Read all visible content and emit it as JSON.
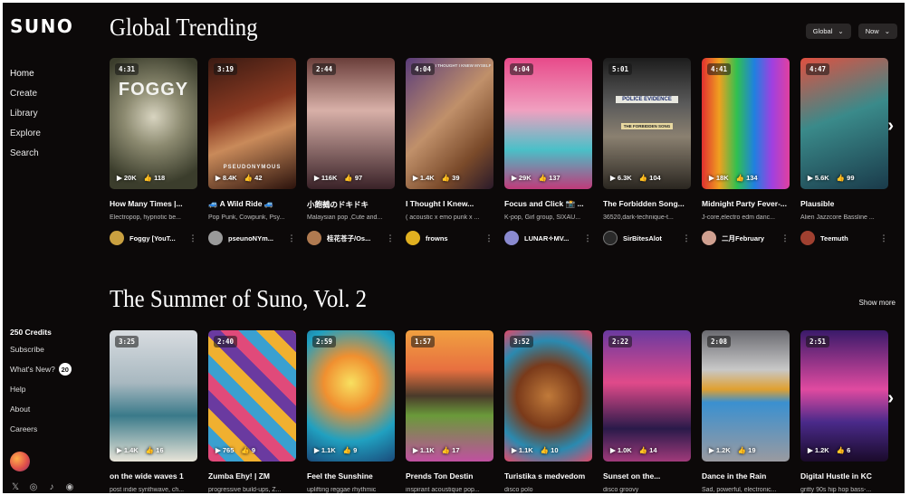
{
  "app": {
    "logo": "SUNO"
  },
  "sidebar": {
    "nav": [
      "Home",
      "Create",
      "Library",
      "Explore",
      "Search"
    ],
    "credits": "250 Credits",
    "subscribe": "Subscribe",
    "whats_new": "What's New?",
    "whats_new_count": "20",
    "help": "Help",
    "about": "About",
    "careers": "Careers",
    "socials": [
      "x-icon",
      "instagram-icon",
      "tiktok-icon",
      "discord-icon"
    ]
  },
  "trending": {
    "title": "Global Trending",
    "filter_region": "Global",
    "filter_time": "Now",
    "songs": [
      {
        "duration": "4:31",
        "plays": "20K",
        "likes": "118",
        "title": "How Many Times |...",
        "genre": "Electropop, hypnotic be...",
        "artist": "Foggy [YouT..."
      },
      {
        "duration": "3:19",
        "plays": "8.4K",
        "likes": "42",
        "title": "🚙 A Wild Ride 🚙",
        "genre": "Pop Punk, Cowpunk, Psy...",
        "artist": "pseunoNYm..."
      },
      {
        "duration": "2:44",
        "plays": "116K",
        "likes": "97",
        "title": "小飽鵺のドキドキ",
        "genre": "Malaysian pop ,Cute and...",
        "artist": "桂花苍子/Os..."
      },
      {
        "duration": "4:04",
        "plays": "1.4K",
        "likes": "39",
        "title": "I Thought I Knew...",
        "genre": "( acoustic x emo punk x ...",
        "artist": "frowns"
      },
      {
        "duration": "4:04",
        "plays": "29K",
        "likes": "137",
        "title": "Focus and Click 📸 ...",
        "genre": "K-pop, Girl group, SIXAU...",
        "artist": "LUNAR✧MV..."
      },
      {
        "duration": "5:01",
        "plays": "6.3K",
        "likes": "104",
        "title": "The Forbidden Song...",
        "genre": "36520,dark-technique-t...",
        "artist": "SirBitesAlot"
      },
      {
        "duration": "4:41",
        "plays": "18K",
        "likes": "134",
        "title": "Midnight Party Fever-...",
        "genre": "J-core,electro edm danc...",
        "artist": "二月February"
      },
      {
        "duration": "4:47",
        "plays": "5.6K",
        "likes": "99",
        "title": "Plausible",
        "genre": "Alien Jazzcore Bassline ...",
        "artist": "Teemuth"
      }
    ]
  },
  "summer": {
    "title": "The Summer of Suno, Vol. 2",
    "show_more": "Show more",
    "songs": [
      {
        "duration": "3:25",
        "plays": "1.4K",
        "likes": "16",
        "title": "on the wide waves 1",
        "genre": "post indie synthwave, ch..."
      },
      {
        "duration": "2:40",
        "plays": "765",
        "likes": "9",
        "title": "Zumba Ehy! | ZM",
        "genre": "progressive build-ups, Z..."
      },
      {
        "duration": "2:59",
        "plays": "1.1K",
        "likes": "9",
        "title": "Feel the Sunshine",
        "genre": "uplifting reggae rhythmic"
      },
      {
        "duration": "1:57",
        "plays": "1.1K",
        "likes": "17",
        "title": "Prends Ton Destin",
        "genre": "inspirant acoustique pop..."
      },
      {
        "duration": "3:52",
        "plays": "1.1K",
        "likes": "10",
        "title": "Turistika s medvedom",
        "genre": "disco polo"
      },
      {
        "duration": "2:22",
        "plays": "1.0K",
        "likes": "14",
        "title": "Sunset on the...",
        "genre": "disco groovy"
      },
      {
        "duration": "2:08",
        "plays": "1.2K",
        "likes": "19",
        "title": "Dance in the Rain",
        "genre": "Sad, powerful, electronic..."
      },
      {
        "duration": "2:51",
        "plays": "1.2K",
        "likes": "6",
        "title": "Digital Hustle in KC",
        "genre": "gritty 90s hip hop bass-..."
      }
    ]
  },
  "cover_text": {
    "foggy": "FOGGY",
    "pseudo": "PSEUDONYMOUS",
    "police": "POLICE EVIDENCE",
    "forbidden": "THE FORBIDDEN SONG",
    "knew": "I THOUGHT I KNEW MYSELF"
  },
  "glyphs": {
    "play": "▶",
    "like": "👍",
    "chevron": "⌄",
    "next": "›",
    "more": "⋮"
  }
}
